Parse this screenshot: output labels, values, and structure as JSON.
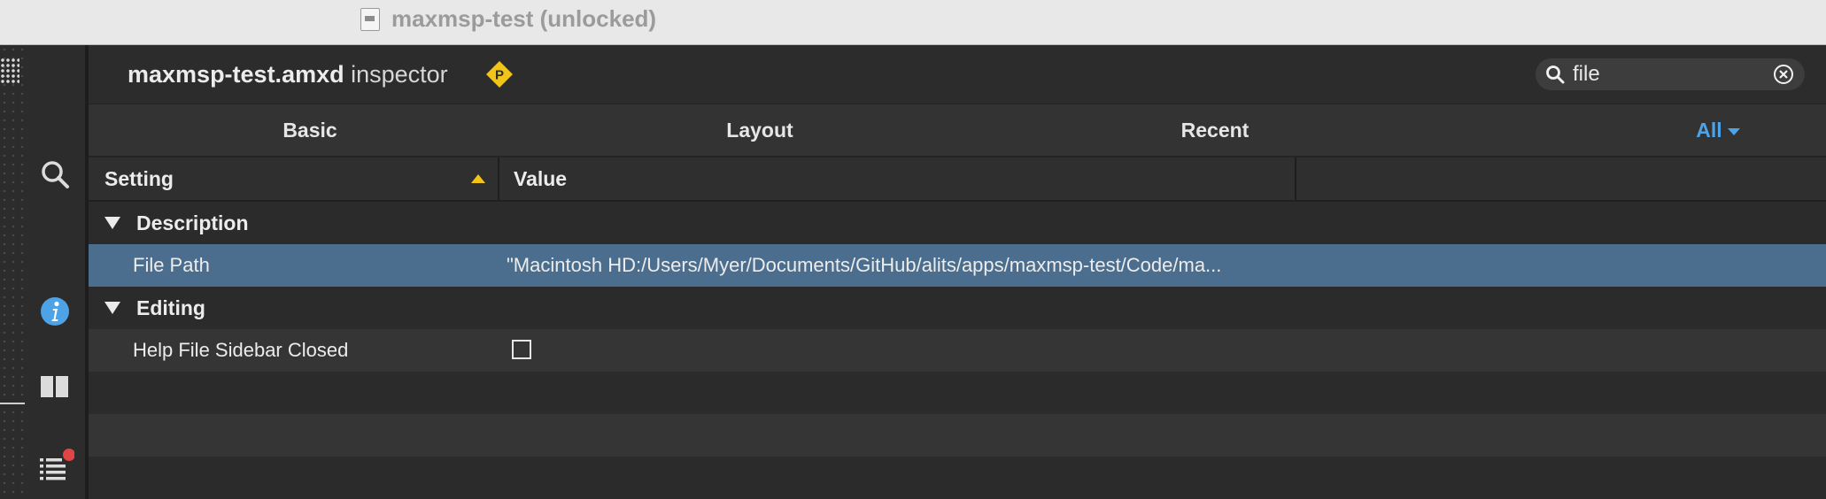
{
  "window": {
    "title": "maxmsp-test (unlocked)"
  },
  "inspector": {
    "title_bold": "maxmsp-test.amxd",
    "title_rest": " inspector",
    "presentation_letter": "P"
  },
  "search": {
    "value": "file"
  },
  "tabs": [
    {
      "label": "Basic"
    },
    {
      "label": "Layout"
    },
    {
      "label": "Recent"
    },
    {
      "label": "All"
    }
  ],
  "columns": {
    "setting": "Setting",
    "value": "Value"
  },
  "rows": [
    {
      "label": "Description"
    },
    {
      "label": "File Path",
      "value": "\"Macintosh HD:/Users/Myer/Documents/GitHub/alits/apps/maxmsp-test/Code/ma..."
    },
    {
      "label": "Editing"
    },
    {
      "label": "Help File Sidebar Closed",
      "checked": false
    }
  ],
  "colors": {
    "accent": "#4ea3e6",
    "selection": "#4b6e8f",
    "presentation": "#f0c419",
    "badge": "#e04545"
  },
  "icons": {
    "sidebar": [
      "search-icon",
      "info-icon",
      "columns-icon",
      "list-icon"
    ],
    "header": [
      "presentation-icon",
      "search-icon",
      "clear-icon"
    ]
  }
}
